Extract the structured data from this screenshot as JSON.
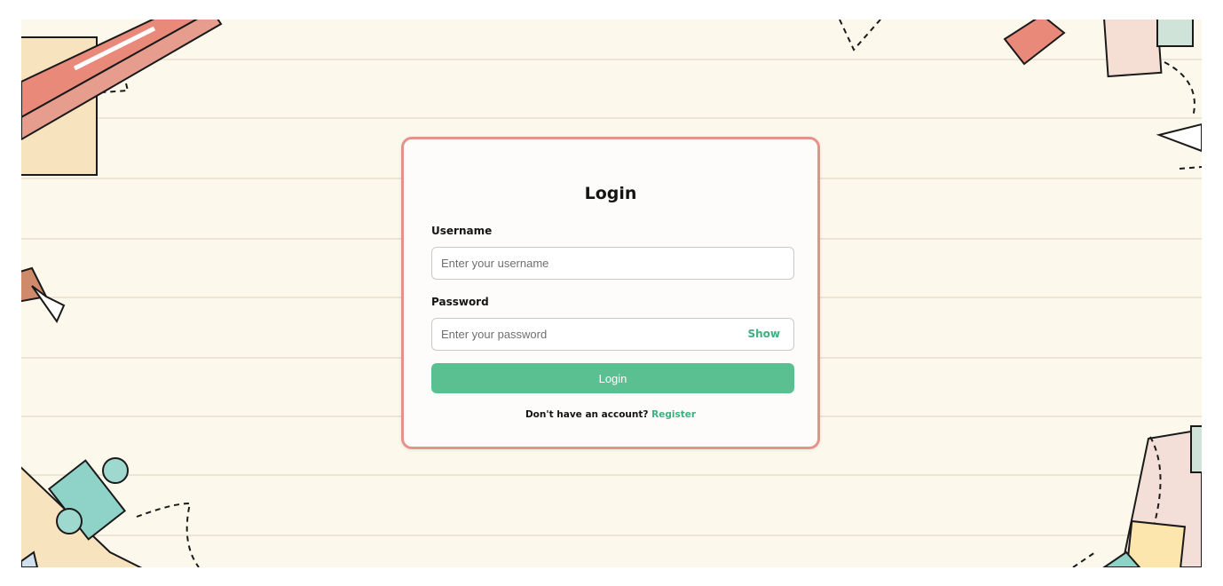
{
  "login_form": {
    "title": "Login",
    "username": {
      "label": "Username",
      "placeholder": "Enter your username",
      "value": ""
    },
    "password": {
      "label": "Password",
      "placeholder": "Enter your password",
      "value": "",
      "toggle_label": "Show"
    },
    "submit_label": "Login",
    "register_prompt": "Don't have an account?",
    "register_link": "Register"
  },
  "colors": {
    "background": "#fdf8ec",
    "card_border": "#e4928a",
    "accent_green": "#5ac091",
    "link_green": "#3fae80"
  }
}
